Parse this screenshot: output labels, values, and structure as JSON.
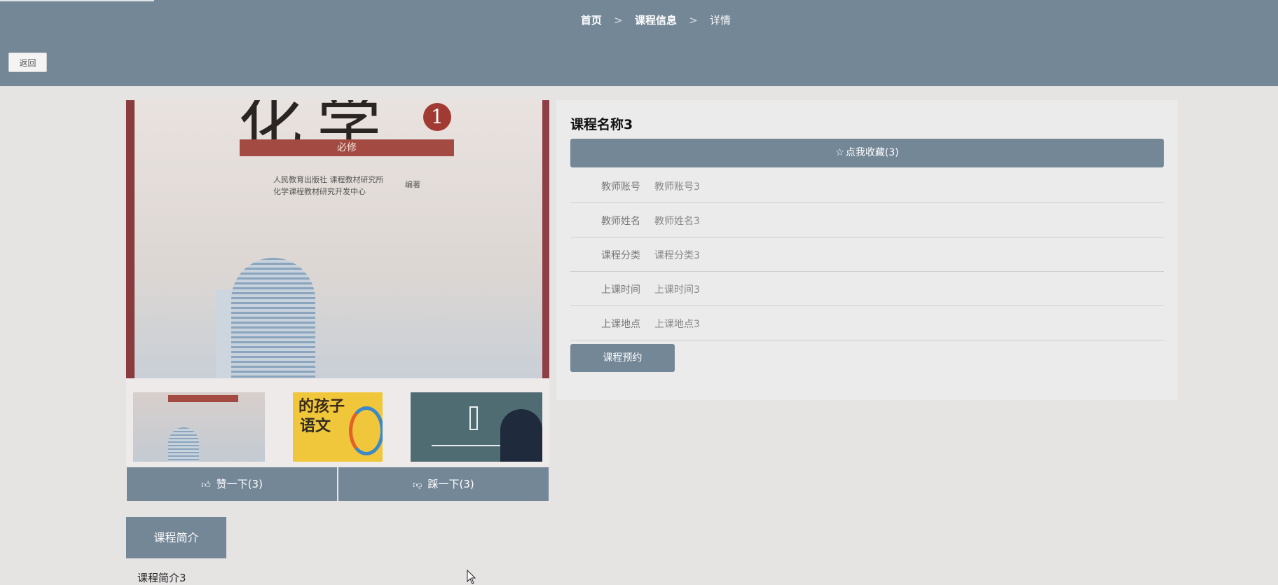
{
  "breadcrumb": {
    "home": "首页",
    "section": "课程信息",
    "current": "详情",
    "separator": ">"
  },
  "back_button": "返回",
  "main_image": {
    "title_text": "化学",
    "number": "1",
    "band_text": "必修",
    "publisher_line1": "人民教育出版社  课程教材研究所",
    "publisher_line2": "化学课程教材研究开发中心",
    "publisher_suffix": "编著"
  },
  "thumbnails": {
    "t2_line1": "的孩子",
    "t2_line2": "语文"
  },
  "vote": {
    "like_label": "赞一下(3)",
    "dislike_label": "踩一下(3)",
    "like_icon": "thumbs-up-icon",
    "dislike_icon": "thumbs-down-icon"
  },
  "course": {
    "name": "课程名称3",
    "favorite_label": "点我收藏(3)",
    "favorite_icon": "star-outline-icon",
    "fields": [
      {
        "label": "教师账号",
        "value": "教师账号3"
      },
      {
        "label": "教师姓名",
        "value": "教师姓名3"
      },
      {
        "label": "课程分类",
        "value": "课程分类3"
      },
      {
        "label": "上课时间",
        "value": "上课时间3"
      },
      {
        "label": "上课地点",
        "value": "上课地点3"
      }
    ],
    "book_label": "课程预约"
  },
  "intro": {
    "tab_label": "课程简介",
    "text": "课程简介3"
  },
  "colors": {
    "accent": "#748797",
    "page_bg": "#e6e3e3",
    "panel_bg": "#ebebeb"
  }
}
